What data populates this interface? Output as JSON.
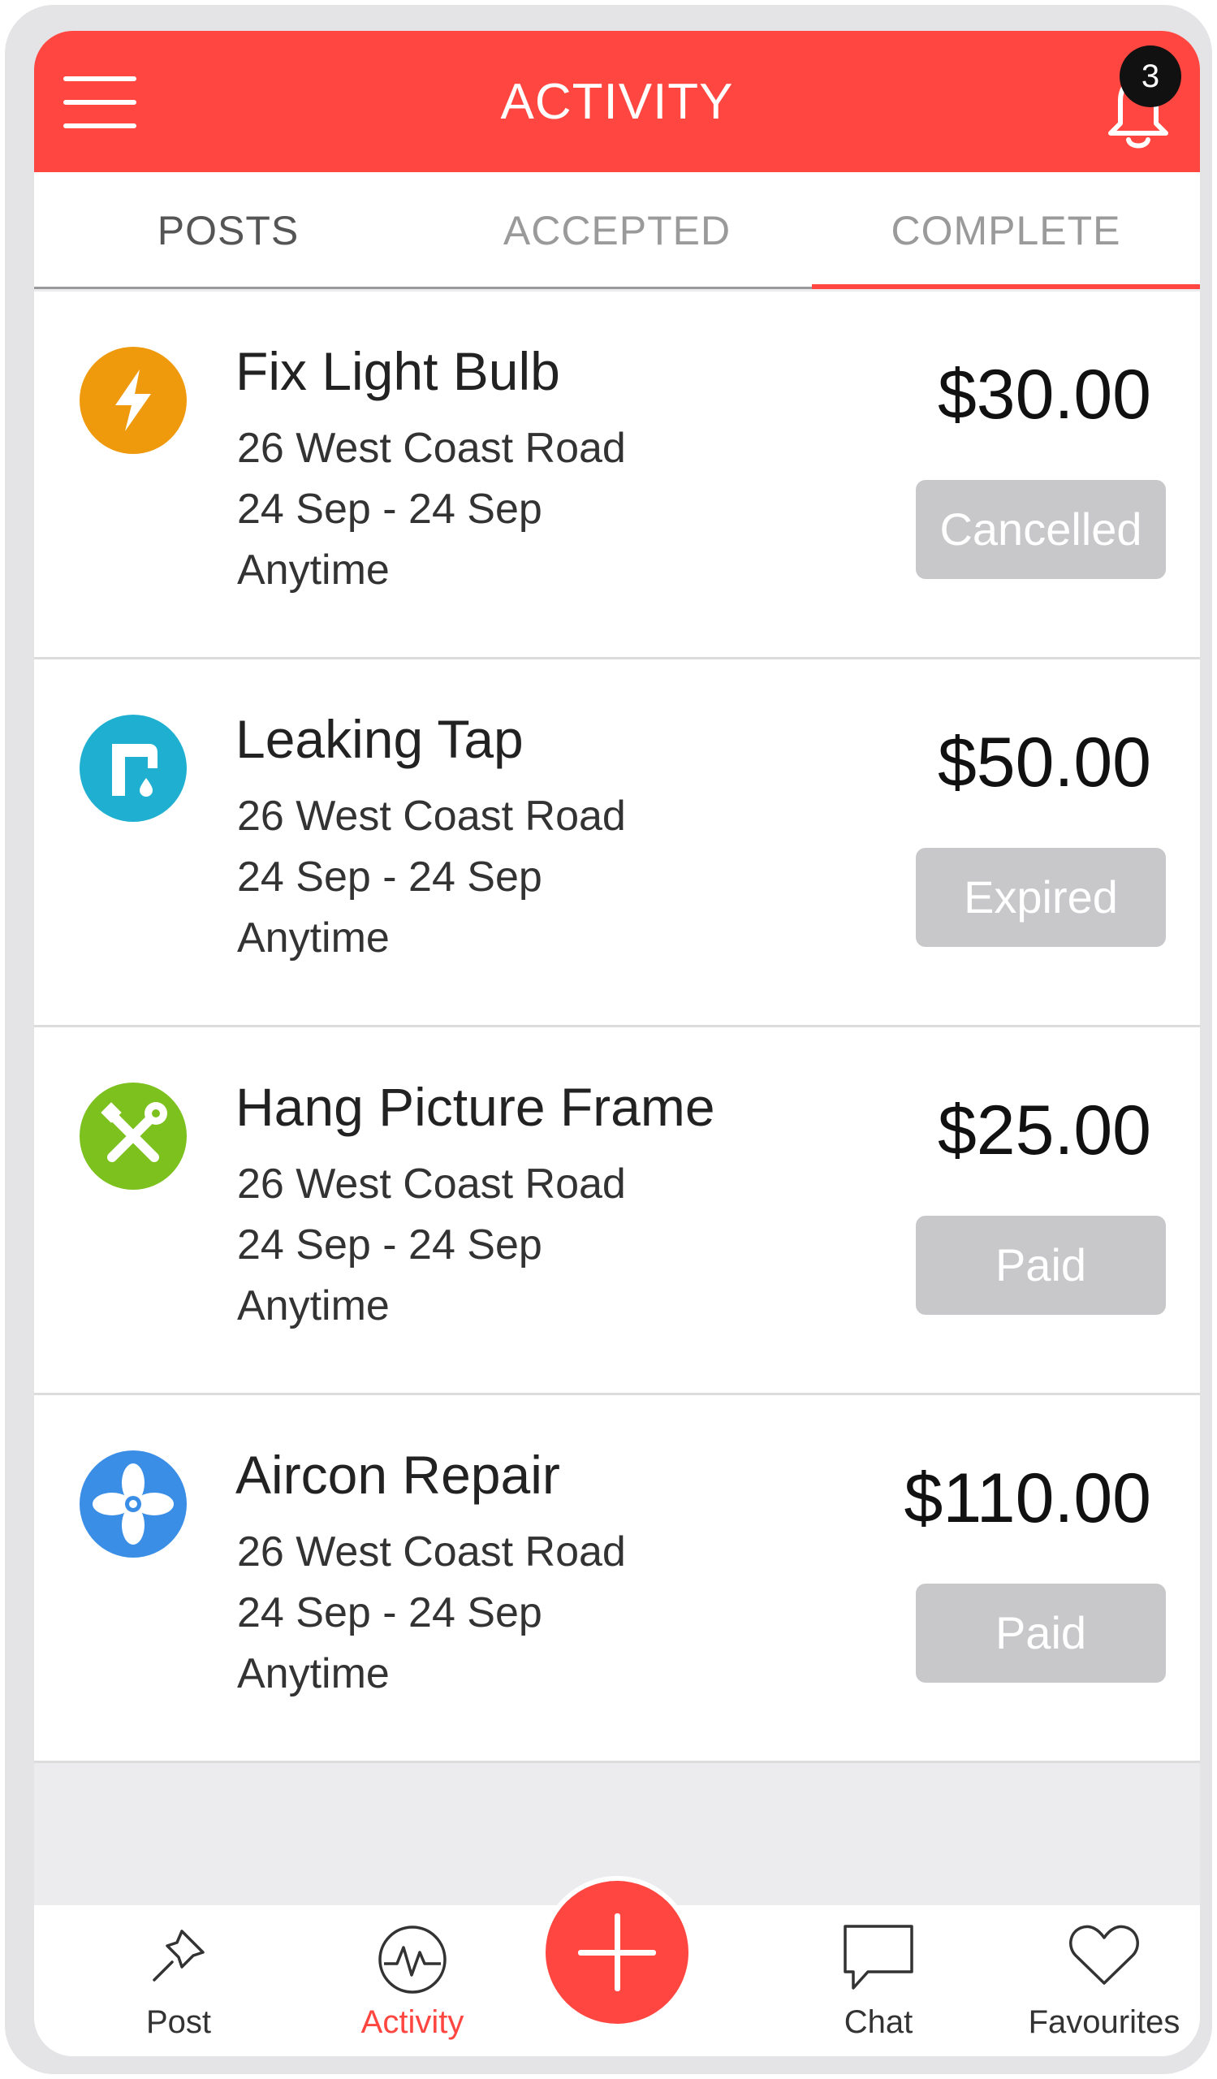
{
  "header": {
    "title": "ACTIVITY",
    "notification_count": "3",
    "accent_color": "#ff4640"
  },
  "tabs": [
    {
      "label": "POSTS",
      "active": false
    },
    {
      "label": "ACCEPTED",
      "active": false
    },
    {
      "label": "COMPLETE",
      "active": true
    }
  ],
  "jobs": [
    {
      "icon": "lightning-icon",
      "icon_color": "#ef9a0d",
      "title": "Fix Light Bulb",
      "address": "26 West Coast Road",
      "dates": "24 Sep - 24 Sep",
      "time": "Anytime",
      "price": "$30.00",
      "status": "Cancelled"
    },
    {
      "icon": "tap-icon",
      "icon_color": "#1fb0d1",
      "title": "Leaking Tap",
      "address": "26 West Coast Road",
      "dates": "24 Sep - 24 Sep",
      "time": "Anytime",
      "price": "$50.00",
      "status": "Expired"
    },
    {
      "icon": "tools-icon",
      "icon_color": "#7cc11e",
      "title": "Hang Picture Frame",
      "address": "26 West Coast Road",
      "dates": "24 Sep - 24 Sep",
      "time": "Anytime",
      "price": "$25.00",
      "status": "Paid"
    },
    {
      "icon": "fan-icon",
      "icon_color": "#3a8ee6",
      "title": "Aircon Repair",
      "address": "26 West Coast Road",
      "dates": "24 Sep - 24 Sep",
      "time": "Anytime",
      "price": "$110.00",
      "status": "Paid"
    }
  ],
  "bottom_nav": [
    {
      "label": "Post",
      "icon": "pin-icon"
    },
    {
      "label": "Activity",
      "icon": "activity-icon",
      "active": true
    },
    {
      "label": "Chat",
      "icon": "chat-icon"
    },
    {
      "label": "Favourites",
      "icon": "heart-icon"
    }
  ],
  "fab": {
    "icon": "plus-icon"
  }
}
